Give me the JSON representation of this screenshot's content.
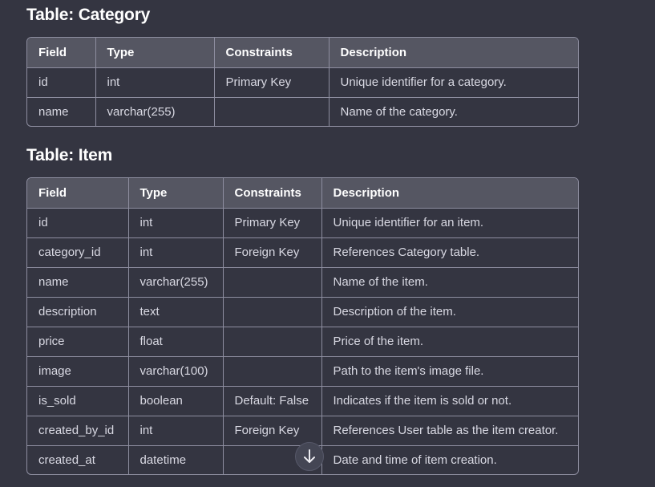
{
  "category_table": {
    "heading": "Table: Category",
    "columns": [
      "Field",
      "Type",
      "Constraints",
      "Description"
    ],
    "rows": [
      [
        "id",
        "int",
        "Primary Key",
        "Unique identifier for a category."
      ],
      [
        "name",
        "varchar(255)",
        "",
        "Name of the category."
      ]
    ]
  },
  "item_table": {
    "heading": "Table: Item",
    "columns": [
      "Field",
      "Type",
      "Constraints",
      "Description"
    ],
    "rows": [
      [
        "id",
        "int",
        "Primary Key",
        "Unique identifier for an item."
      ],
      [
        "category_id",
        "int",
        "Foreign Key",
        "References Category table."
      ],
      [
        "name",
        "varchar(255)",
        "",
        "Name of the item."
      ],
      [
        "description",
        "text",
        "",
        "Description of the item."
      ],
      [
        "price",
        "float",
        "",
        "Price of the item."
      ],
      [
        "image",
        "varchar(100)",
        "",
        "Path to the item's image file."
      ],
      [
        "is_sold",
        "boolean",
        "Default: False",
        "Indicates if the item is sold or not."
      ],
      [
        "created_by_id",
        "int",
        "Foreign Key",
        "References User table as the item creator."
      ],
      [
        "created_at",
        "datetime",
        "",
        "Date and time of item creation."
      ]
    ]
  },
  "scroll_button": {
    "icon": "arrow-down-icon"
  },
  "colors": {
    "background": "#343541",
    "header_row": "#555662",
    "border": "#8e8ea0",
    "text": "#ececf1"
  }
}
